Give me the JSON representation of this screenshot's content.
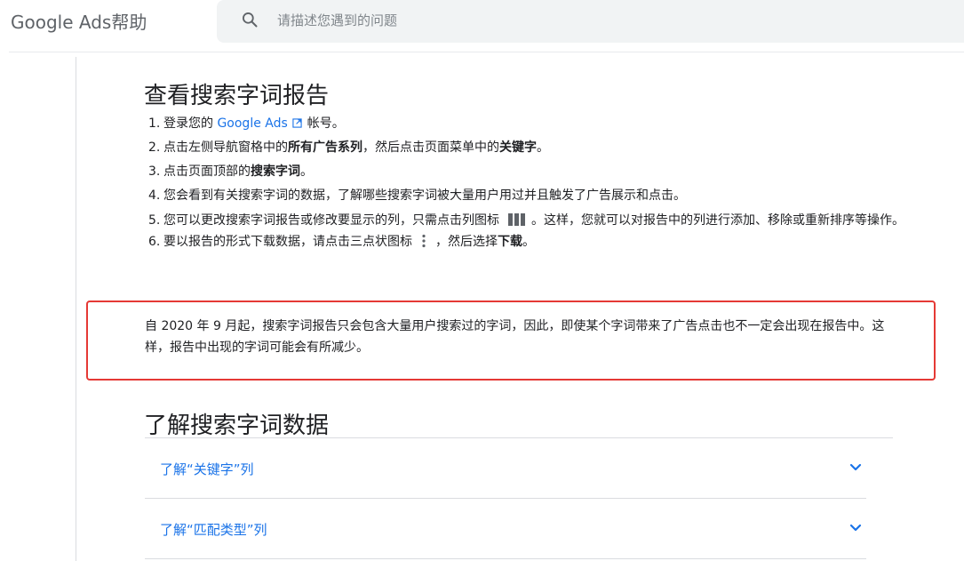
{
  "header": {
    "brand": "Google Ads帮助",
    "search_placeholder": "请描述您遇到的问题"
  },
  "section1": {
    "title": "查看搜索字词报告",
    "steps": [
      {
        "num": "1.",
        "pre": "登录您的",
        "link": "Google Ads",
        "post": "帐号。"
      },
      {
        "num": "2.",
        "pre": "点击左侧导航窗格中的",
        "bold1": "所有广告系列",
        "mid": "，然后点击页面菜单中的",
        "bold2": "关键字",
        "post": "。"
      },
      {
        "num": "3.",
        "pre": "点击页面顶部的",
        "bold1": "搜索字词",
        "post": "。"
      },
      {
        "num": "4.",
        "text": "您会看到有关搜索字词的数据，了解哪些搜索字词被大量用户用过并且触发了广告展示和点击。"
      },
      {
        "num": "5.",
        "pre": "您可以更改搜索字词报告或修改要显示的列，只需点击列图标",
        "post": "。这样，您就可以对报告中的列进行添加、移除或重新排序等操作。"
      },
      {
        "num": "6.",
        "pre": "要以报告的形式下载数据，请点击三点状图标",
        "mid": "，然后选择",
        "bold1": "下载",
        "post": "。"
      }
    ]
  },
  "notice": {
    "text": "自 2020 年 9 月起，搜索字词报告只会包含大量用户搜索过的字词，因此，即使某个字词带来了广告点击也不一定会出现在报告中。这样，报告中出现的字词可能会有所减少。",
    "border_color": "#e53935"
  },
  "section2": {
    "title": "了解搜索字词数据",
    "accordion": [
      {
        "label": "了解“关键字”列"
      },
      {
        "label": "了解“匹配类型”列"
      }
    ]
  },
  "colors": {
    "link": "#1a73e8",
    "text": "#202124",
    "search_bg": "#f1f3f4"
  }
}
